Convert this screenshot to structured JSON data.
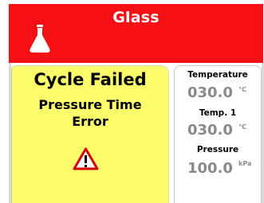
{
  "header": {
    "title": "Glass",
    "icon": "flask-icon",
    "color": "#f70f16"
  },
  "alarm": {
    "title": "Cycle Failed",
    "message_line1": "Pressure Time",
    "message_line2": "Error",
    "icon": "warning-icon",
    "background": "#fdfc6a"
  },
  "readings": [
    {
      "label": "Temperature",
      "value": "030.0",
      "unit": "°C"
    },
    {
      "label": "Temp. 1",
      "value": "030.0",
      "unit": "°C"
    },
    {
      "label": "Pressure",
      "value": "100.0",
      "unit": "kPa"
    }
  ]
}
